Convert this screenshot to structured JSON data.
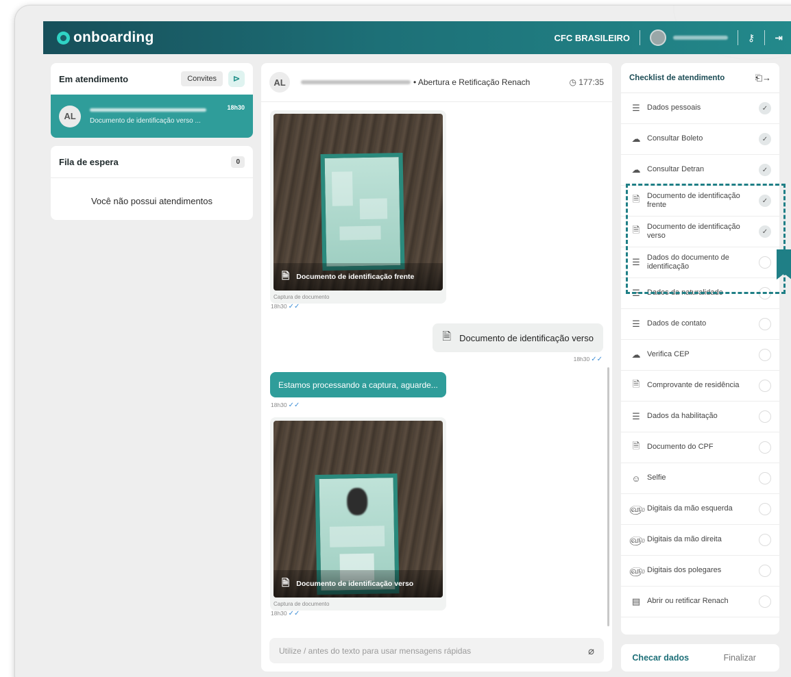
{
  "topbar": {
    "logo_text": "onboarding",
    "company": "CFC BRASILEIRO"
  },
  "attendance": {
    "title": "Em atendimento",
    "invites_button": "Convites",
    "active_chat": {
      "initials": "AL",
      "preview": "Documento de identificação verso ...",
      "time": "18h30"
    }
  },
  "queue": {
    "title": "Fila de espera",
    "count": "0",
    "empty_message": "Você não possui atendimentos"
  },
  "chat": {
    "initials": "AL",
    "subject": "• Abertura e Retificação Renach",
    "timer": "177:35",
    "messages": {
      "photo1_caption": "Documento de identificação frente",
      "photo1_sub": "Captura de documento",
      "photo1_time": "18h30",
      "out_doc_label": "Documento de identificação verso",
      "out_doc_time": "18h30",
      "processing_text": "Estamos processando a captura, aguarde...",
      "processing_time": "18h30",
      "photo2_caption": "Documento de identificação verso",
      "photo2_sub": "Captura de documento",
      "photo2_time": "18h30"
    },
    "input_placeholder": "Utilize / antes do texto para usar mensagens rápidas"
  },
  "checklist": {
    "title": "Checklist de atendimento",
    "items": [
      {
        "label": "Dados pessoais",
        "icon": "form-edit-icon",
        "done": true
      },
      {
        "label": "Consultar Boleto",
        "icon": "cloud-search-icon",
        "done": true
      },
      {
        "label": "Consultar Detran",
        "icon": "cloud-search-icon",
        "done": true
      },
      {
        "label": "Documento de identificação frente",
        "icon": "document-icon",
        "done": true
      },
      {
        "label": "Documento de identificação verso",
        "icon": "document-icon",
        "done": true
      },
      {
        "label": "Dados do documento de identificação",
        "icon": "form-edit-icon",
        "done": false
      },
      {
        "label": "Dados da naturalidade",
        "icon": "form-edit-icon",
        "done": false
      },
      {
        "label": "Dados de contato",
        "icon": "form-edit-icon",
        "done": false
      },
      {
        "label": "Verifica CEP",
        "icon": "cloud-search-icon",
        "done": false
      },
      {
        "label": "Comprovante de residência",
        "icon": "document-icon",
        "done": false
      },
      {
        "label": "Dados da habilitação",
        "icon": "form-edit-icon",
        "done": false
      },
      {
        "label": "Documento do CPF",
        "icon": "document-icon",
        "done": false
      },
      {
        "label": "Selfie",
        "icon": "face-icon",
        "done": false
      },
      {
        "label": "Digitais da mão esquerda",
        "icon": "fingerprint-icon",
        "done": false
      },
      {
        "label": "Digitais da mão direita",
        "icon": "fingerprint-icon",
        "done": false
      },
      {
        "label": "Digitais dos polegares",
        "icon": "fingerprint-icon",
        "done": false
      },
      {
        "label": "Abrir ou retificar Renach",
        "icon": "server-icon",
        "done": false
      }
    ]
  },
  "actions": {
    "check_data": "Checar dados",
    "finish": "Finalizar"
  },
  "colors": {
    "brand_dark": "#174f5a",
    "brand_teal": "#2f9d9a",
    "highlight": "#1f7f86"
  }
}
